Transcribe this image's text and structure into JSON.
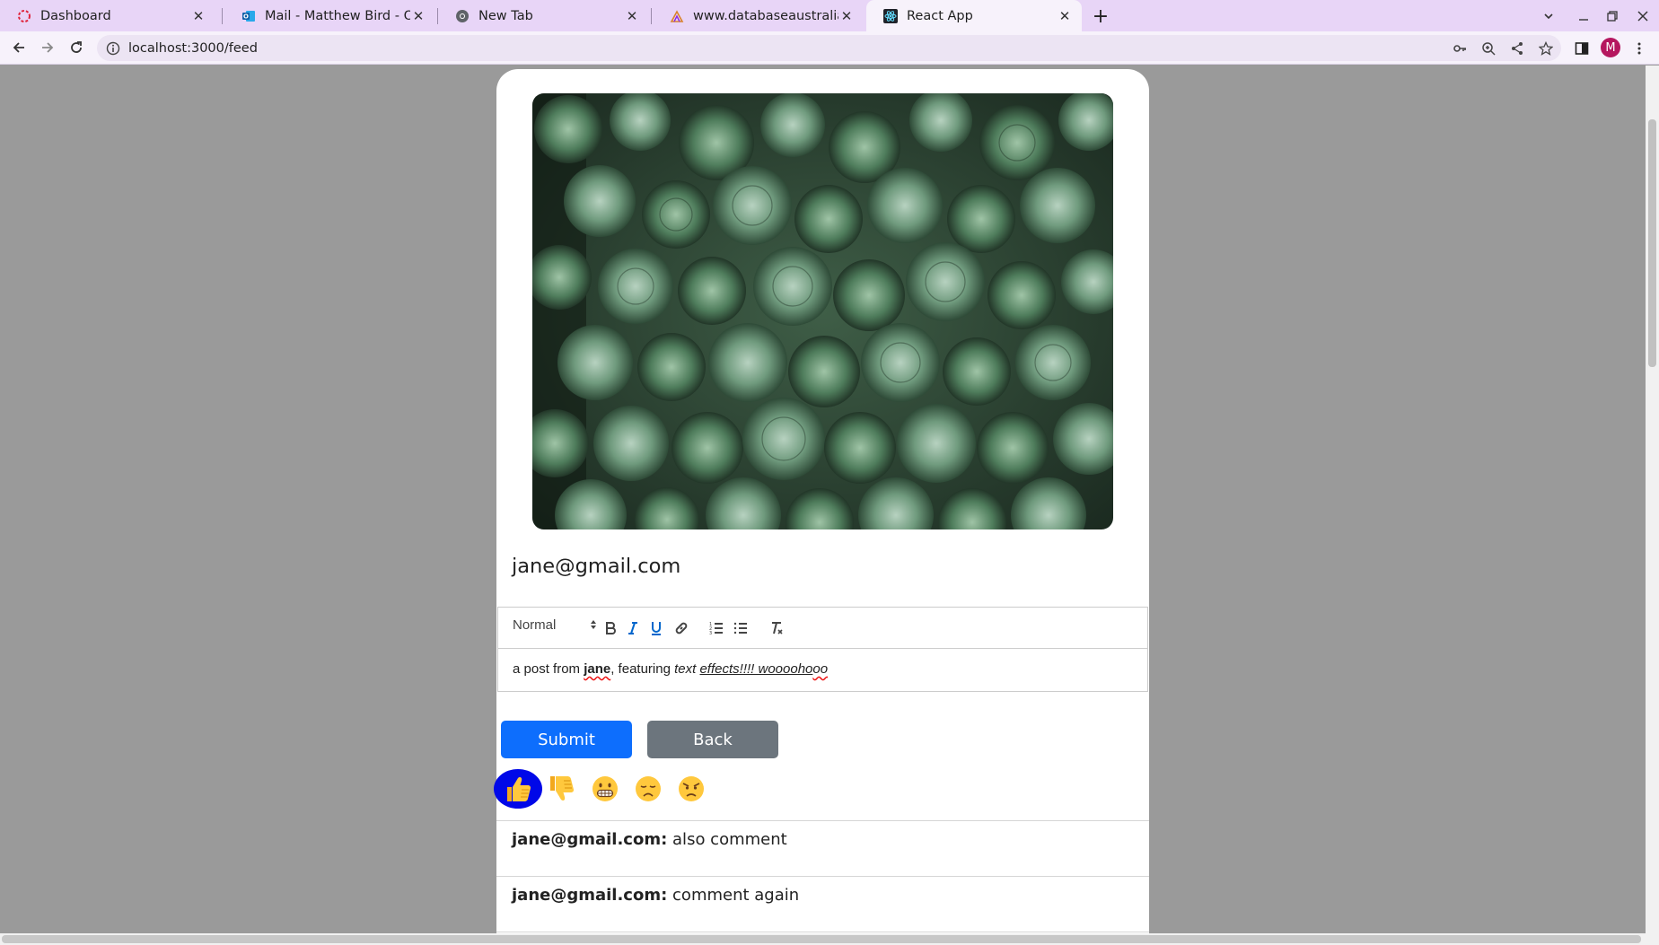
{
  "browser": {
    "tabs": [
      {
        "title": "Dashboard",
        "icon": "dashboard-favicon"
      },
      {
        "title": "Mail - Matthew Bird - Outlook",
        "icon": "outlook-icon"
      },
      {
        "title": "New Tab",
        "icon": "chrome-icon"
      },
      {
        "title": "www.databaseaustralia.com",
        "icon": "database-australia-favicon"
      },
      {
        "title": "React App",
        "icon": "react-icon"
      }
    ],
    "active_tab": 4,
    "url": "localhost:3000/feed",
    "profile_initial": "M",
    "accent_color": "#e8d5f7"
  },
  "post": {
    "author": "jane@gmail.com",
    "image_alt": "succulent plants photo"
  },
  "editor": {
    "size_label": "Normal",
    "content": {
      "p1": "a post from ",
      "bold": "jane",
      "p2": ", featuring ",
      "italic": "text",
      "p3": " ",
      "italic_underlined": "effects!!!! wooooho",
      "italic_underlined_wavy": "oo"
    }
  },
  "buttons": {
    "submit": "Submit",
    "back": "Back"
  },
  "reactions": [
    {
      "emoji": "👍",
      "name": "thumbs-up",
      "selected": true
    },
    {
      "emoji": "👎",
      "name": "thumbs-down",
      "selected": false
    },
    {
      "emoji": "😁",
      "name": "grin",
      "selected": false
    },
    {
      "emoji": "😞",
      "name": "disappointed",
      "selected": false
    },
    {
      "emoji": "😠",
      "name": "angry",
      "selected": false
    }
  ],
  "comments": [
    {
      "author": "jane@gmail.com:",
      "text": "also comment"
    },
    {
      "author": "jane@gmail.com:",
      "text": "comment again"
    }
  ]
}
